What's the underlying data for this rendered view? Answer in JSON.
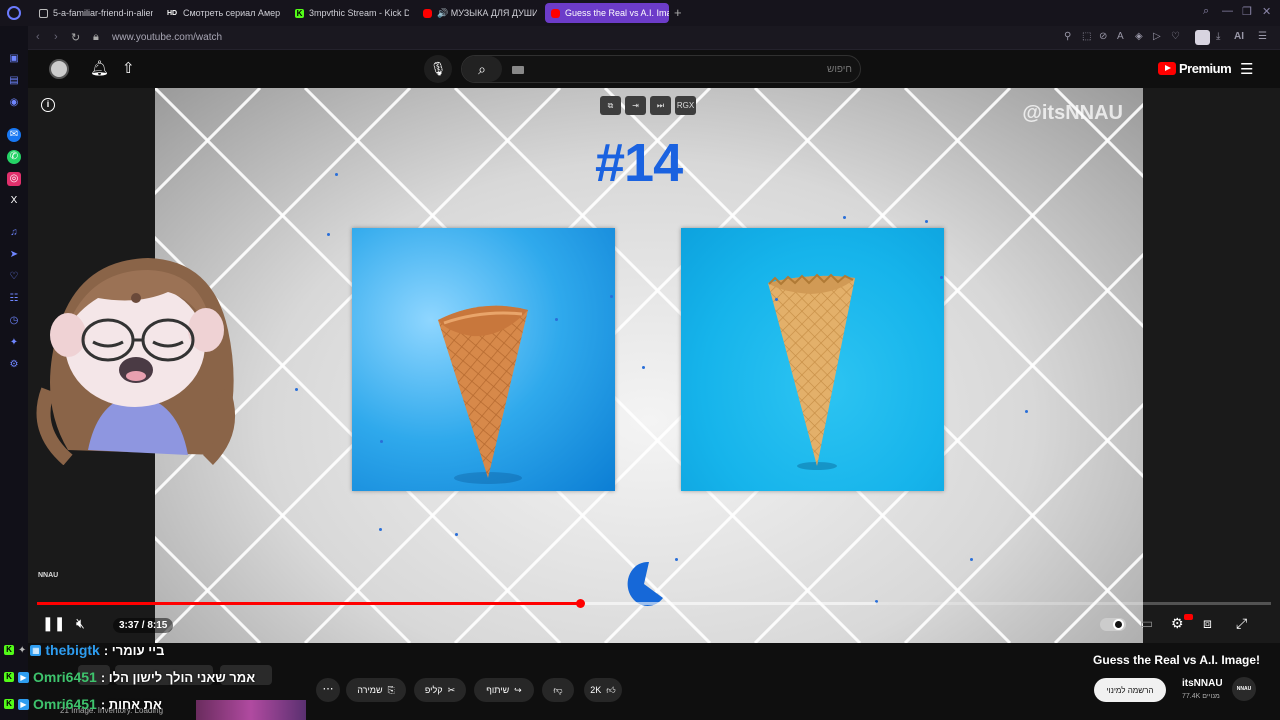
{
  "browser": {
    "tabs": [
      {
        "title": "5-a-familiar-friend-in-alien-",
        "favicon": "doc-icon"
      },
      {
        "title": "Смотреть сериал Америк",
        "favicon": "hd-icon"
      },
      {
        "title": "3mpvthic Stream - Kick D",
        "favicon": "kick-icon"
      },
      {
        "title": "🔊 МУЗЫКА ДЛЯ ДУШИ",
        "favicon": "youtube-icon"
      },
      {
        "title": "Guess the Real vs A.I. Imag",
        "favicon": "youtube-icon",
        "active": true
      }
    ],
    "url": "www.youtube.com/watch",
    "ai_label": "AI",
    "accent": "#6c3cc9"
  },
  "header": {
    "search_placeholder": "חיפוש",
    "brand": "Premium"
  },
  "video": {
    "watermark": "@itsNNAU",
    "round_label": "#14",
    "brand_corner": "NNAU",
    "overlay_buttons": [
      "RGX"
    ],
    "time_current": "3:37",
    "time_total": "8:15",
    "time_text": "3:37 / 8:15",
    "progress_fraction": 0.44,
    "buffered_fraction": 0.68
  },
  "below": {
    "title": "Guess the Real vs A.I. Image!",
    "channel_name": "itsNNAU",
    "channel_avatar_text": "NNAU",
    "subscribers": "77.4K מנויים",
    "subscribe_label": "הרשמה למינוי",
    "like_count": "2K",
    "share_label": "שיתוף",
    "clip_label": "קליפ",
    "save_label": "שמירה"
  },
  "chat": [
    {
      "user": "thebigtk",
      "user_color": "#2e9df0",
      "message": ": ביי עומרי"
    },
    {
      "user": "Omri6451",
      "user_color": "#3ec46d",
      "message": ": אמר שאני הולך לישון הלו"
    },
    {
      "user": "Omri6451",
      "user_color": "#3ec46d",
      "message": ": את אחות"
    }
  ],
  "next_up": {
    "meta": "21 Image. Inventory. Loading"
  }
}
